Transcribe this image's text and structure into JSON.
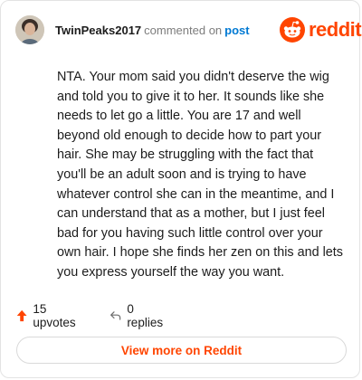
{
  "comment": {
    "username": "TwinPeaks2017",
    "action_text": "commented on",
    "link_text": "post",
    "body": "NTA. Your mom said you didn't deserve the wig and told you to give it to her. It sounds like she needs to let go a little. You are 17 and well beyond old enough to decide how to part your hair. She may be struggling with the fact that you'll be an adult soon and is trying to have whatever control she can in the meantime, and I can understand that as a mother, but I just feel bad for you having such little control over your own hair. I hope she finds her zen on this and lets you express yourself the way you want."
  },
  "brand": {
    "name": "reddit",
    "color": "#ff4500"
  },
  "footer": {
    "upvotes_label": "15 upvotes",
    "replies_label": "0 replies",
    "view_more_label": "View more on Reddit"
  },
  "icons": {
    "avatar": "user-avatar",
    "logo": "reddit-logo-icon",
    "upvote": "upvote-arrow-icon",
    "reply": "reply-arrow-icon"
  }
}
